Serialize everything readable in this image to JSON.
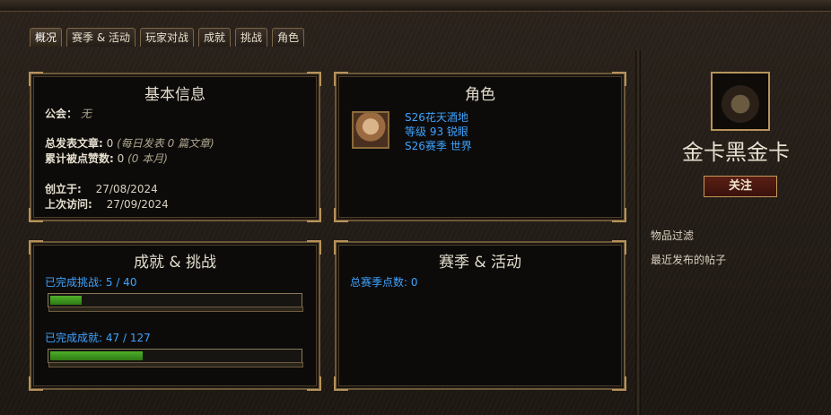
{
  "tabs": [
    {
      "label": "概况",
      "active": true
    },
    {
      "label": "赛季 & 活动"
    },
    {
      "label": "玩家对战"
    },
    {
      "label": "成就"
    },
    {
      "label": "挑战"
    },
    {
      "label": "角色"
    }
  ],
  "basic_info": {
    "title": "基本信息",
    "guild_label": "公会：",
    "guild_value": "无",
    "posts_label": "总发表文章:",
    "posts_value": "0",
    "posts_note": "(每日发表 0 篇文章)",
    "likes_label": "累计被点赞数:",
    "likes_value": "0",
    "likes_note": "(0 本月)",
    "created_label": "创立于:",
    "created_value": "27/08/2024",
    "last_visit_label": "上次访问:",
    "last_visit_value": "27/09/2024"
  },
  "characters": {
    "title": "角色",
    "entry": {
      "name": "S26花天酒地",
      "level_class": "等级 93 锐眼",
      "season_world": "S26赛季 世界"
    }
  },
  "achievements": {
    "title": "成就 & 挑战",
    "challenges_label": "已完成挑战:",
    "challenges_value": "5 / 40",
    "challenges_progress": 0.125,
    "achievements_label": "已完成成就:",
    "achievements_value": "47 / 127",
    "achievements_progress": 0.37
  },
  "season": {
    "title": "赛季 & 活动",
    "points_label": "总赛季点数:",
    "points_value": "0"
  },
  "sidebar": {
    "player_name": "金卡黑金卡",
    "follow_label": "关注",
    "filter_label": "物品过滤",
    "recent_posts_label": "最近发布的帖子"
  },
  "colors": {
    "link": "#3fa3ff",
    "progress_fill": "#4fb02a",
    "frame_gold": "#b8935a",
    "follow_button": "#5a1e14"
  }
}
